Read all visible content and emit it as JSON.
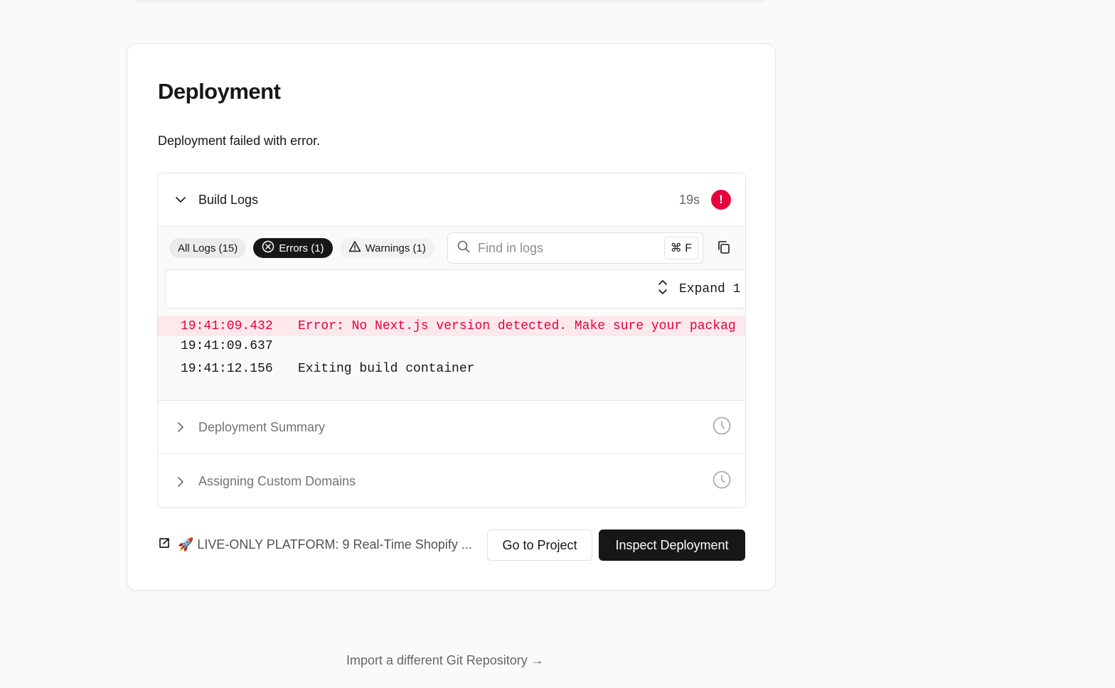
{
  "card": {
    "title": "Deployment",
    "status_message": "Deployment failed with error."
  },
  "build_logs": {
    "label": "Build Logs",
    "duration": "19s",
    "status_icon": "error-icon",
    "error_badge_glyph": "!",
    "filters": {
      "all": "All Logs (15)",
      "errors": "Errors (1)",
      "warnings": "Warnings (1)"
    },
    "search": {
      "placeholder": "Find in logs",
      "shortcut": "⌘ F"
    },
    "expand_label": "Expand 1",
    "lines": [
      {
        "time": "19:41:09.432",
        "message": "Error: No Next.js version detected. Make sure your packag",
        "level": "error"
      },
      {
        "time": "19:41:09.637",
        "message": "",
        "level": "info"
      },
      {
        "time": "19:41:12.156",
        "message": "Exiting build container",
        "level": "info"
      }
    ]
  },
  "sections": [
    {
      "label": "Deployment Summary",
      "icon": "clock-icon"
    },
    {
      "label": "Assigning Custom Domains",
      "icon": "clock-icon"
    }
  ],
  "footer": {
    "repo_link": "🚀 LIVE-ONLY PLATFORM: 9 Real-Time Shopify ...",
    "go_to_project": "Go to Project",
    "inspect_deployment": "Inspect Deployment"
  },
  "import_link": "Import a different Git Repository →",
  "colors": {
    "error": "#e5003c",
    "error_bg": "#fde8ec",
    "primary_button": "#171717"
  }
}
